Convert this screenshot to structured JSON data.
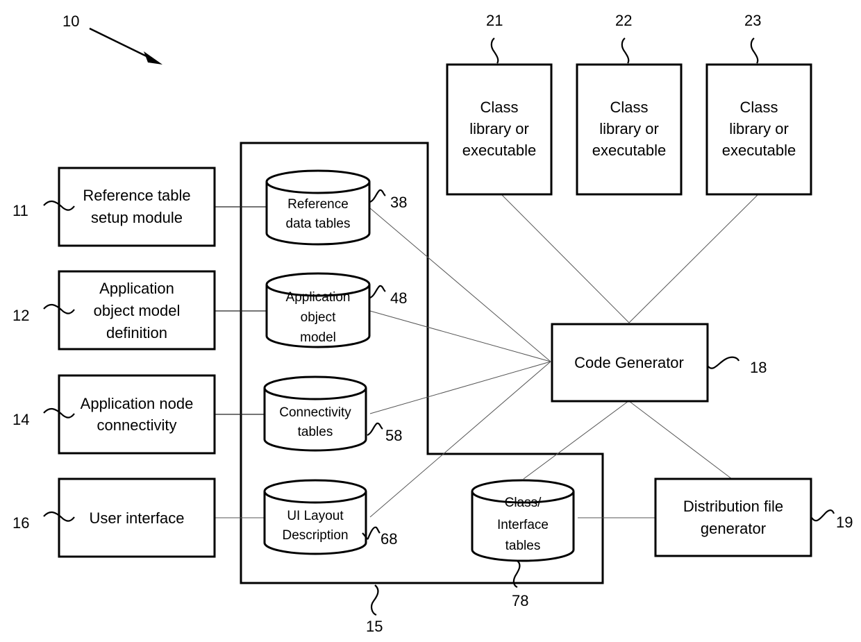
{
  "figure": {
    "reference": "10",
    "container": {
      "ref": "15"
    }
  },
  "left_modules": [
    {
      "ref": "11",
      "lines": [
        "Reference table",
        "setup module"
      ]
    },
    {
      "ref": "12",
      "lines": [
        "Application",
        "object model",
        "definition"
      ]
    },
    {
      "ref": "14",
      "lines": [
        "Application node",
        "connectivity"
      ]
    },
    {
      "ref": "16",
      "lines": [
        "User interface"
      ]
    }
  ],
  "databases": [
    {
      "ref": "38",
      "lines": [
        "Reference",
        "data tables"
      ]
    },
    {
      "ref": "48",
      "lines": [
        "Application",
        "object",
        "model"
      ]
    },
    {
      "ref": "58",
      "lines": [
        "Connectivity",
        "tables"
      ]
    },
    {
      "ref": "68",
      "lines": [
        "UI Layout",
        "Description"
      ]
    },
    {
      "ref": "78",
      "lines": [
        "Class/",
        "Interface",
        "tables"
      ]
    }
  ],
  "libraries": [
    {
      "ref": "21",
      "lines": [
        "Class",
        "library or",
        "executable"
      ]
    },
    {
      "ref": "22",
      "lines": [
        "Class",
        "library or",
        "executable"
      ]
    },
    {
      "ref": "23",
      "lines": [
        "Class",
        "library or",
        "executable"
      ]
    }
  ],
  "code_generator": {
    "ref": "18",
    "label": "Code Generator"
  },
  "distribution": {
    "ref": "19",
    "lines": [
      "Distribution file",
      "generator"
    ]
  },
  "connections": [
    {
      "from": "11",
      "to": "38"
    },
    {
      "from": "12",
      "to": "48"
    },
    {
      "from": "14",
      "to": "58"
    },
    {
      "from": "16",
      "to": "68"
    },
    {
      "from": "38",
      "to": "18"
    },
    {
      "from": "48",
      "to": "18"
    },
    {
      "from": "58",
      "to": "18"
    },
    {
      "from": "68",
      "to": "18"
    },
    {
      "from": "78",
      "to": "18"
    },
    {
      "from": "21",
      "to": "18"
    },
    {
      "from": "23",
      "to": "18"
    },
    {
      "from": "18",
      "to": "19"
    },
    {
      "from": "78",
      "to": "19"
    }
  ]
}
